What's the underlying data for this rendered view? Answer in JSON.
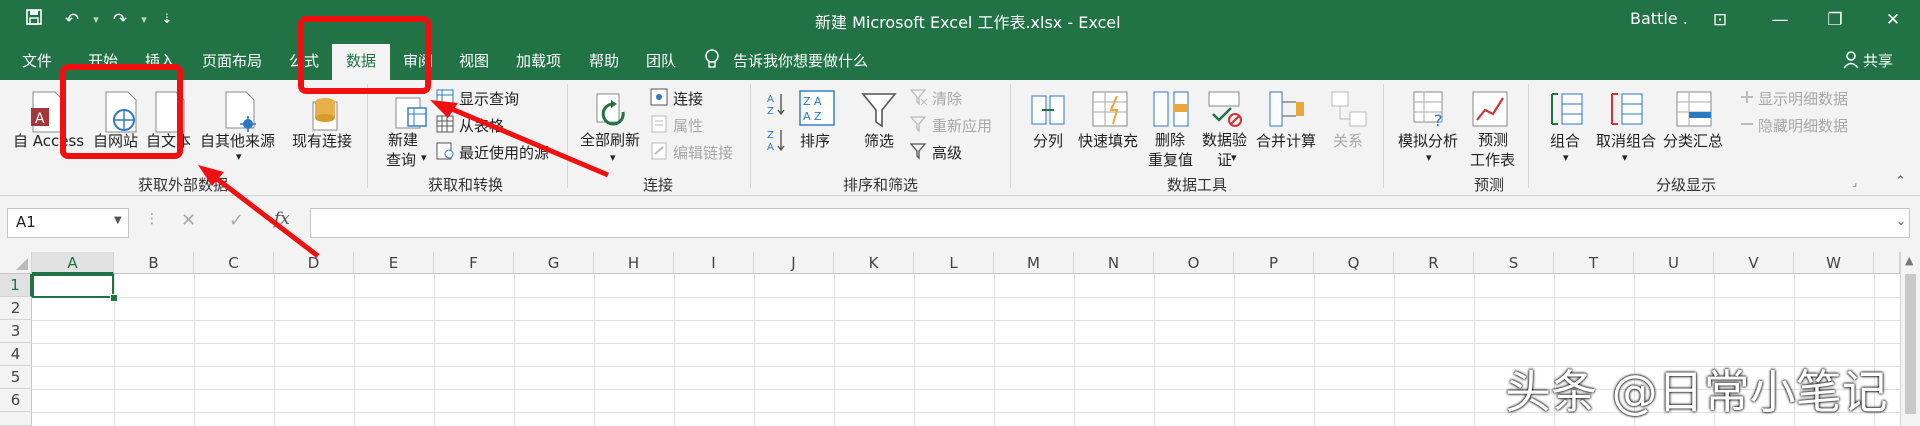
{
  "titlebar": {
    "title": "新建 Microsoft Excel 工作表.xlsx  -  Excel",
    "user": "Battle .",
    "save_glyph": "💾",
    "undo_glyph": "↶",
    "redo_glyph": "↷",
    "qa_glyph": "⇣",
    "ribbon_glyph": "⊡",
    "min_glyph": "—",
    "max_glyph": "❐",
    "close_glyph": "✕"
  },
  "tabs": [
    "文件",
    "开始",
    "插入",
    "页面布局",
    "公式",
    "数据",
    "审阅",
    "视图",
    "加载项",
    "帮助",
    "团队"
  ],
  "tell_me": "告诉我你想要做什么",
  "share": "共享",
  "ribbon": {
    "get_external": {
      "from_access": "自 Access",
      "from_web": "自网站",
      "from_text": "自文本",
      "from_other": "自其他来源",
      "existing": "现有连接",
      "group": "获取外部数据"
    },
    "get_transform": {
      "new_query_1": "新建",
      "new_query_2": "查询",
      "show_queries": "显示查询",
      "from_table": "从表格",
      "recent_sources": "最近使用的源",
      "group": "获取和转换"
    },
    "connections": {
      "refresh_all": "全部刷新",
      "connections": "连接",
      "properties": "属性",
      "edit_links": "编辑链接",
      "group": "连接"
    },
    "sort_filter": {
      "sort": "排序",
      "filter": "筛选",
      "clear": "清除",
      "reapply": "重新应用",
      "advanced": "高级",
      "group": "排序和筛选"
    },
    "data_tools": {
      "text_to_columns": "分列",
      "flash_fill": "快速填充",
      "remove_dup_1": "删除",
      "remove_dup_2": "重复值",
      "validation_1": "数据验",
      "validation_2": "证",
      "consolidate": "合并计算",
      "relationships": "关系",
      "group": "数据工具"
    },
    "forecast": {
      "what_if": "模拟分析",
      "sheet_1": "预测",
      "sheet_2": "工作表",
      "group": "预测"
    },
    "outline": {
      "group_btn": "组合",
      "ungroup": "取消组合",
      "subtotal": "分类汇总",
      "show_detail": "显示明细数据",
      "hide_detail": "隐藏明细数据",
      "group": "分级显示"
    }
  },
  "formula_bar": {
    "name_box": "A1",
    "cancel": "✕",
    "enter": "✓",
    "fx": "fx"
  },
  "columns": [
    "A",
    "B",
    "C",
    "D",
    "E",
    "F",
    "G",
    "H",
    "I",
    "J",
    "K",
    "L",
    "M",
    "N",
    "O",
    "P",
    "Q",
    "R",
    "S",
    "T",
    "U",
    "V",
    "W"
  ],
  "rows": [
    "1",
    "2",
    "3",
    "4",
    "5",
    "6"
  ],
  "watermark": "头条 @日常小笔记",
  "colors": {
    "excel_green": "#217346",
    "annotation_red": "#f01010"
  }
}
